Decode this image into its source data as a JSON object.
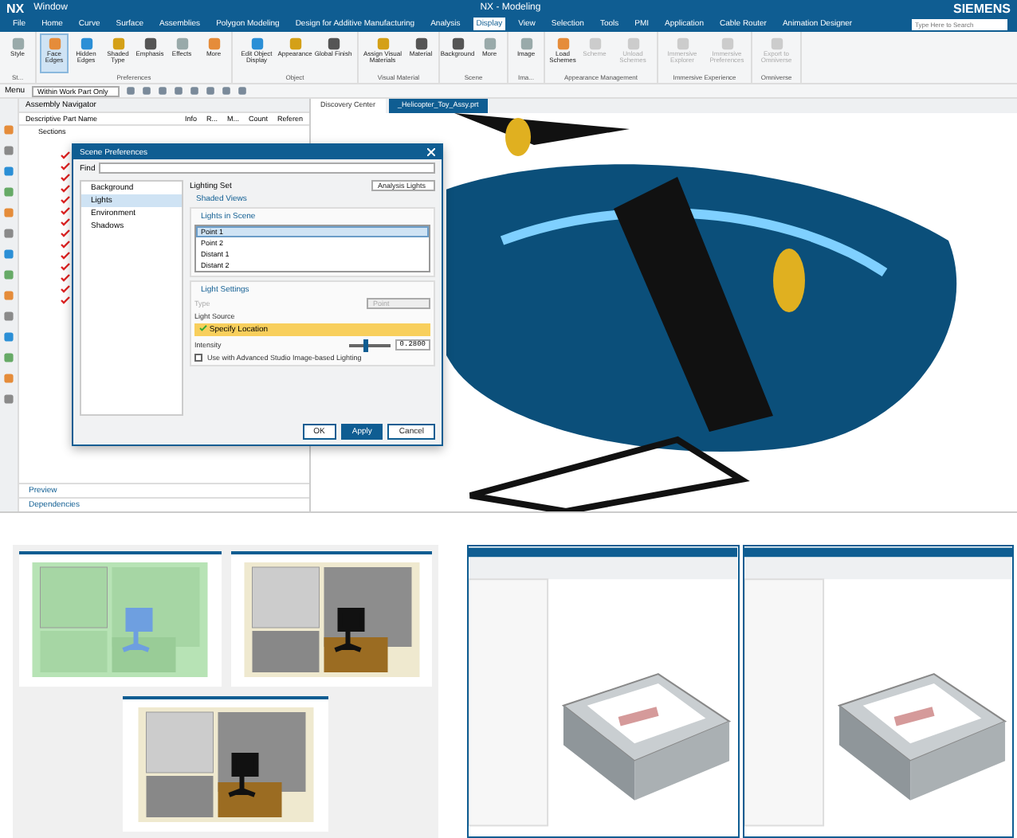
{
  "window": {
    "logo": "NX",
    "quick_access": "Window",
    "title": "NX - Modeling",
    "brand": "SIEMENS",
    "search": {
      "placeholder": "Type Here to Search"
    }
  },
  "menu_tabs": [
    {
      "label": "File",
      "selected": false
    },
    {
      "label": "Home",
      "selected": false
    },
    {
      "label": "Curve",
      "selected": false
    },
    {
      "label": "Surface",
      "selected": false
    },
    {
      "label": "Assemblies",
      "selected": false
    },
    {
      "label": "Polygon Modeling",
      "selected": false
    },
    {
      "label": "Design for Additive Manufacturing",
      "selected": false
    },
    {
      "label": "Analysis",
      "selected": false
    },
    {
      "label": "Display",
      "selected": true
    },
    {
      "label": "View",
      "selected": false
    },
    {
      "label": "Selection",
      "selected": false
    },
    {
      "label": "Tools",
      "selected": false
    },
    {
      "label": "PMI",
      "selected": false
    },
    {
      "label": "Application",
      "selected": false
    },
    {
      "label": "Cable Router",
      "selected": false
    },
    {
      "label": "Animation Designer",
      "selected": false
    }
  ],
  "ribbon": [
    {
      "label": "St...",
      "items": [
        {
          "label": "Style",
          "selected": false,
          "disabled": false
        }
      ]
    },
    {
      "label": "Preferences",
      "items": [
        {
          "label": "Face Edges",
          "selected": true,
          "disabled": false
        },
        {
          "label": "Hidden Edges",
          "selected": false,
          "disabled": false
        },
        {
          "label": "Shaded Type",
          "selected": false,
          "disabled": false
        },
        {
          "label": "Emphasis",
          "selected": false,
          "disabled": false
        },
        {
          "label": "Effects",
          "selected": false,
          "disabled": false
        },
        {
          "label": "More",
          "selected": false,
          "disabled": false
        }
      ]
    },
    {
      "label": "Object",
      "items": [
        {
          "label": "Edit Object Display",
          "selected": false,
          "disabled": false
        },
        {
          "label": "Appearance",
          "selected": false,
          "disabled": false
        },
        {
          "label": "Global Finish",
          "selected": false,
          "disabled": false
        }
      ]
    },
    {
      "label": "Visual Material",
      "items": [
        {
          "label": "Assign Visual Materials",
          "selected": false,
          "disabled": false
        },
        {
          "label": "Material",
          "selected": false,
          "disabled": false
        }
      ]
    },
    {
      "label": "Scene",
      "items": [
        {
          "label": "Background",
          "selected": false,
          "disabled": false
        },
        {
          "label": "More",
          "selected": false,
          "disabled": false
        }
      ]
    },
    {
      "label": "Ima...",
      "items": [
        {
          "label": "Image",
          "selected": false,
          "disabled": false
        }
      ]
    },
    {
      "label": "Appearance Management",
      "items": [
        {
          "label": "Load Schemes",
          "selected": false,
          "disabled": false
        },
        {
          "label": "Scheme",
          "selected": false,
          "disabled": true
        },
        {
          "label": "Unload Schemes",
          "selected": false,
          "disabled": true
        }
      ]
    },
    {
      "label": "Immersive Experience",
      "items": [
        {
          "label": "Immersive Explorer",
          "selected": false,
          "disabled": true
        },
        {
          "label": "Immersive Preferences",
          "selected": false,
          "disabled": true
        }
      ]
    },
    {
      "label": "Omniverse",
      "items": [
        {
          "label": "Export to Omniverse",
          "selected": false,
          "disabled": true
        }
      ]
    }
  ],
  "toolbar": {
    "menu": "Menu",
    "filter": "Within Work Part Only"
  },
  "navigator": {
    "title": "Assembly Navigator",
    "columns": [
      "Descriptive Part Name",
      "Info",
      "R...",
      "M...",
      "Count",
      "Referen"
    ],
    "first_row": "Sections",
    "rows": [
      {
        "checked": true
      },
      {
        "checked": true
      },
      {
        "checked": true
      },
      {
        "checked": true
      },
      {
        "checked": true
      },
      {
        "checked": true
      },
      {
        "checked": true
      },
      {
        "checked": true
      },
      {
        "checked": true
      },
      {
        "checked": true
      },
      {
        "checked": true
      },
      {
        "checked": true
      },
      {
        "checked": true
      },
      {
        "checked": true
      }
    ],
    "sections": [
      "Preview",
      "Dependencies"
    ]
  },
  "doc_tabs": [
    {
      "label": "Discovery Center",
      "selected": false
    },
    {
      "label": "_Helicopter_Toy_Assy.prt",
      "selected": true
    }
  ],
  "dialog": {
    "title": "Scene Preferences",
    "find": "Find",
    "categories": [
      {
        "label": "Background",
        "selected": false
      },
      {
        "label": "Lights",
        "selected": true
      },
      {
        "label": "Environment",
        "selected": false
      },
      {
        "label": "Shadows",
        "selected": false
      }
    ],
    "lighting_set_label": "Lighting Set",
    "lighting_set": "Analysis Lights",
    "shaded_views": "Shaded Views",
    "lights_in_scene": "Lights in Scene",
    "lights": [
      {
        "label": "Point 1",
        "selected": true
      },
      {
        "label": "Point 2",
        "selected": false
      },
      {
        "label": "Distant 1",
        "selected": false
      },
      {
        "label": "Distant 2",
        "selected": false
      }
    ],
    "light_settings": "Light Settings",
    "type_label": "Type",
    "type_value": "Point",
    "light_source": "Light Source",
    "specify_location": "Specify Location",
    "intensity_label": "Intensity",
    "intensity": {
      "level": 0.35
    },
    "intensity_value": "0.2800",
    "ibl": {
      "label": "Use with Advanced Studio Image-based Lighting",
      "checked": false
    },
    "buttons": [
      {
        "label": "OK",
        "primary": false
      },
      {
        "label": "Apply",
        "primary": true
      },
      {
        "label": "Cancel",
        "primary": false
      }
    ]
  }
}
